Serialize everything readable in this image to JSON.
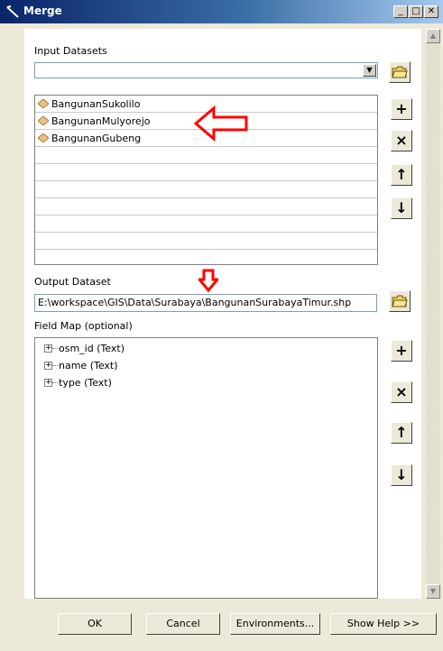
{
  "window": {
    "title": "Merge",
    "minimize_label": "_",
    "maximize_label": "□",
    "close_label": "✕"
  },
  "input_datasets": {
    "label": "Input Datasets",
    "combo_value": "",
    "datasets": [
      "BangunanSukolilo",
      "BangunanMulyorejo",
      "BangunanGubeng"
    ]
  },
  "side_buttons": {
    "add_label": "+",
    "remove_label": "×",
    "up_label": "↑",
    "down_label": "↓"
  },
  "output_dataset": {
    "label": "Output Dataset",
    "value": "E:\\workspace\\GIS\\Data\\Surabaya\\BangunanSurabayaTimur.shp"
  },
  "field_map": {
    "label": "Field Map (optional)",
    "fields": [
      "osm_id (Text)",
      "name (Text)",
      "type (Text)"
    ]
  },
  "buttons": {
    "ok": "OK",
    "cancel": "Cancel",
    "environments": "Environments...",
    "show_help": "Show Help >>"
  },
  "colors": {
    "annotation_arrow": "#ff0000",
    "dataset_icon": "#e8c08a",
    "titlebar": "#0a246a"
  },
  "icons": {
    "open_folder": "open-folder-icon",
    "dataset": "polygon-feature-class-icon"
  }
}
